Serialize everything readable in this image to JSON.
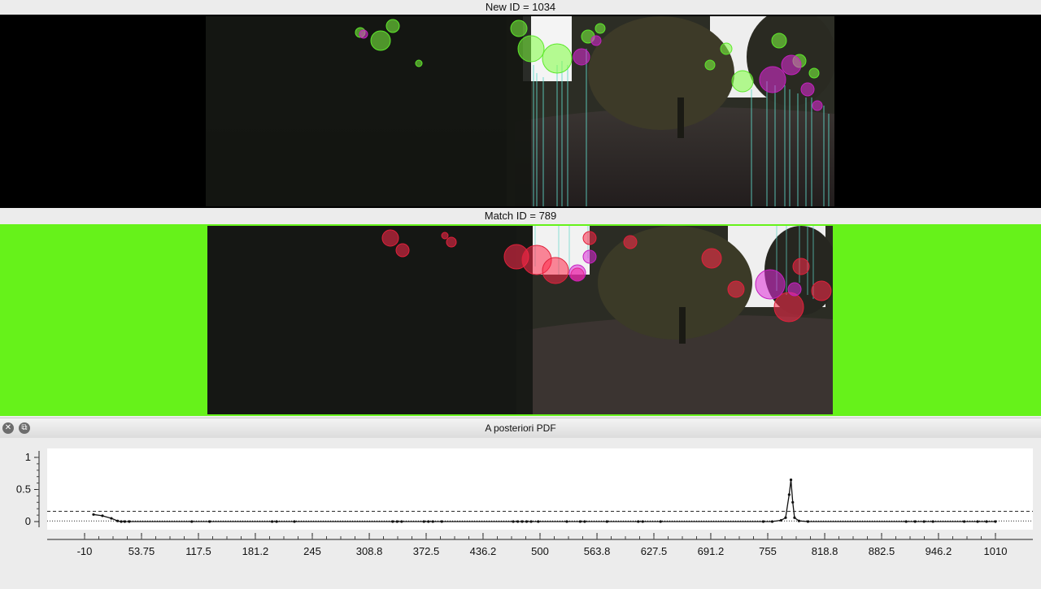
{
  "top_panel": {
    "title": "New ID = 1034"
  },
  "bottom_panel": {
    "title": "Match ID = 789"
  },
  "pdf_window": {
    "title": "A posteriori PDF",
    "close_icon": "close-icon",
    "restore_icon": "restore-icon"
  },
  "colors": {
    "match_background": "#66f21a",
    "new_background": "#000000",
    "new_features": "#7fff3f",
    "match_features": "#ff2a4a",
    "feature_alt": "#e02bd8",
    "match_lines": "#5fd8c8"
  },
  "chart_data": {
    "type": "line",
    "title": "A posteriori PDF",
    "xlabel": "",
    "ylabel": "",
    "xlim": [
      -10,
      1010
    ],
    "ylim": [
      0,
      1
    ],
    "x_ticks": [
      "-10",
      "53.75",
      "117.5",
      "181.2",
      "245",
      "308.8",
      "372.5",
      "436.2",
      "500",
      "563.8",
      "627.5",
      "691.2",
      "755",
      "818.8",
      "882.5",
      "946.2",
      "1010"
    ],
    "y_ticks": [
      "0",
      "0.5",
      "1"
    ],
    "threshold_dashed": 0.16,
    "baseline_dotted": 0.01,
    "series": [
      {
        "values_x": [
          0,
          10,
          20,
          27,
          31,
          35,
          40,
          110,
          130,
          200,
          205,
          225,
          335,
          340,
          345,
          370,
          375,
          380,
          390,
          470,
          475,
          480,
          485,
          490,
          498,
          530,
          545,
          550,
          575,
          610,
          615,
          635,
          750,
          760,
          770,
          775,
          779,
          781,
          783,
          785,
          790,
          800,
          910,
          920,
          930,
          940,
          975,
          990,
          1000,
          1010
        ],
        "values_y": [
          0.11,
          0.09,
          0.05,
          0.01,
          0.0,
          0.0,
          0.0,
          0.0,
          0.0,
          0.0,
          0.0,
          0.0,
          0.0,
          0.0,
          0.0,
          0.0,
          0.0,
          0.0,
          0.0,
          0.0,
          0.0,
          0.0,
          0.0,
          0.0,
          0.0,
          0.0,
          0.0,
          0.0,
          0.0,
          0.0,
          0.0,
          0.0,
          0.0,
          0.0,
          0.02,
          0.06,
          0.42,
          0.65,
          0.3,
          0.06,
          0.01,
          0.0,
          0.0,
          0.0,
          0.0,
          0.0,
          0.0,
          0.0,
          0.0,
          0.0
        ]
      }
    ]
  }
}
